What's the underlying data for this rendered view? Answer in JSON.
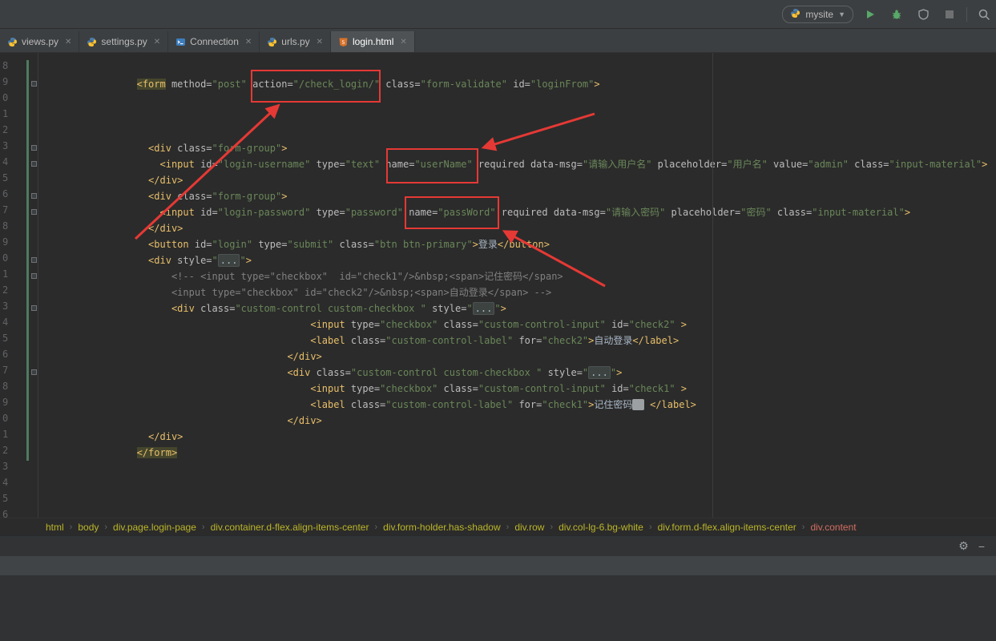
{
  "toolbar": {
    "run_config": "mysite"
  },
  "icons": {
    "gear": "⚙",
    "hide": "−"
  },
  "tabs": [
    {
      "label": "views.py",
      "icon": "python",
      "active": false
    },
    {
      "label": "settings.py",
      "icon": "python",
      "active": false
    },
    {
      "label": "Connection",
      "icon": "console",
      "active": false
    },
    {
      "label": "urls.py",
      "icon": "python",
      "active": false
    },
    {
      "label": "login.html",
      "icon": "html",
      "active": true
    }
  ],
  "editor": {
    "change_bar": {
      "from_row": 0,
      "to_row": 24
    },
    "fold_rows": [
      1,
      5,
      6,
      8,
      9,
      12,
      13,
      15,
      19
    ],
    "lines": [
      {
        "n": "8",
        "ind": 0,
        "segs": []
      },
      {
        "n": "9",
        "ind": 16,
        "segs": [
          [
            "T",
            "<form"
          ],
          [
            "a",
            " method="
          ],
          [
            "v",
            "\"post\""
          ],
          [
            "a",
            " action="
          ],
          [
            "v",
            "\"/check_login/\""
          ],
          [
            "a",
            " class="
          ],
          [
            "v",
            "\"form-validate\""
          ],
          [
            "a",
            " id="
          ],
          [
            "v",
            "\"loginFrom\""
          ],
          [
            "t",
            ">"
          ]
        ]
      },
      {
        "n": "0",
        "ind": 0,
        "segs": []
      },
      {
        "n": "1",
        "ind": 0,
        "segs": []
      },
      {
        "n": "2",
        "ind": 0,
        "segs": []
      },
      {
        "n": "3",
        "ind": 18,
        "segs": [
          [
            "t",
            "<div"
          ],
          [
            "a",
            " class="
          ],
          [
            "v",
            "\"form-group\""
          ],
          [
            "t",
            ">"
          ]
        ]
      },
      {
        "n": "4",
        "ind": 20,
        "segs": [
          [
            "t",
            "<input"
          ],
          [
            "a",
            " id="
          ],
          [
            "v",
            "\"login-username\""
          ],
          [
            "a",
            " type="
          ],
          [
            "v",
            "\"text\""
          ],
          [
            "a",
            " name="
          ],
          [
            "v",
            "\"userName\""
          ],
          [
            "a",
            " required"
          ],
          [
            "a",
            " data-msg="
          ],
          [
            "v",
            "\"请输入用户名\""
          ],
          [
            "a",
            " placeholder="
          ],
          [
            "v",
            "\"用户名\""
          ],
          [
            "a",
            " value="
          ],
          [
            "v",
            "\"admin\""
          ],
          [
            "a",
            " class="
          ],
          [
            "v",
            "\"input-material\""
          ],
          [
            "t",
            ">"
          ]
        ]
      },
      {
        "n": "5",
        "ind": 18,
        "segs": [
          [
            "t",
            "</div>"
          ]
        ]
      },
      {
        "n": "6",
        "ind": 18,
        "segs": [
          [
            "t",
            "<div"
          ],
          [
            "a",
            " class="
          ],
          [
            "v",
            "\"form-group\""
          ],
          [
            "t",
            ">"
          ]
        ]
      },
      {
        "n": "7",
        "ind": 20,
        "segs": [
          [
            "t",
            "<input"
          ],
          [
            "a",
            " id="
          ],
          [
            "v",
            "\"login-password\""
          ],
          [
            "a",
            " type="
          ],
          [
            "v",
            "\"password\""
          ],
          [
            "a",
            " name="
          ],
          [
            "v",
            "\"passWord\""
          ],
          [
            "a",
            " required"
          ],
          [
            "a",
            " data-msg="
          ],
          [
            "v",
            "\"请输入密码\""
          ],
          [
            "a",
            " placeholder="
          ],
          [
            "v",
            "\"密码\""
          ],
          [
            "a",
            " class="
          ],
          [
            "v",
            "\"input-material\""
          ],
          [
            "t",
            ">"
          ]
        ]
      },
      {
        "n": "8",
        "ind": 18,
        "segs": [
          [
            "t",
            "</div>"
          ]
        ]
      },
      {
        "n": "9",
        "ind": 18,
        "segs": [
          [
            "t",
            "<button"
          ],
          [
            "a",
            " id="
          ],
          [
            "v",
            "\"login\""
          ],
          [
            "a",
            " type="
          ],
          [
            "v",
            "\"submit\""
          ],
          [
            "a",
            " class="
          ],
          [
            "v",
            "\"btn btn-primary\""
          ],
          [
            "t",
            ">"
          ],
          [
            "x",
            "登录"
          ],
          [
            "t",
            "</button>"
          ]
        ]
      },
      {
        "n": "0",
        "ind": 18,
        "segs": [
          [
            "t",
            "<div"
          ],
          [
            "a",
            " style="
          ],
          [
            "v",
            "\""
          ],
          [
            "f",
            "..."
          ],
          [
            "v",
            "\""
          ],
          [
            "t",
            ">"
          ]
        ]
      },
      {
        "n": "1",
        "ind": 22,
        "segs": [
          [
            "c",
            "<!-- <input type=\"checkbox\"  id=\"check1\"/>&nbsp;<span>记住密码</span>"
          ]
        ]
      },
      {
        "n": "2",
        "ind": 22,
        "segs": [
          [
            "c",
            "<input type=\"checkbox\" id=\"check2\"/>&nbsp;<span>自动登录</span> -->"
          ]
        ]
      },
      {
        "n": "3",
        "ind": 22,
        "segs": [
          [
            "t",
            "<div"
          ],
          [
            "a",
            " class="
          ],
          [
            "v",
            "\"custom-control custom-checkbox \""
          ],
          [
            "a",
            " style="
          ],
          [
            "v",
            "\""
          ],
          [
            "f",
            "..."
          ],
          [
            "v",
            "\""
          ],
          [
            "t",
            ">"
          ]
        ]
      },
      {
        "n": "4",
        "ind": 46,
        "segs": [
          [
            "t",
            "<input"
          ],
          [
            "a",
            " type="
          ],
          [
            "v",
            "\"checkbox\""
          ],
          [
            "a",
            " class="
          ],
          [
            "v",
            "\"custom-control-input\""
          ],
          [
            "a",
            " id="
          ],
          [
            "v",
            "\"check2\""
          ],
          [
            "t",
            " >"
          ]
        ]
      },
      {
        "n": "5",
        "ind": 46,
        "segs": [
          [
            "t",
            "<label"
          ],
          [
            "a",
            " class="
          ],
          [
            "v",
            "\"custom-control-label\""
          ],
          [
            "a",
            " for="
          ],
          [
            "v",
            "\"check2\""
          ],
          [
            "t",
            ">"
          ],
          [
            "x",
            "自动登录"
          ],
          [
            "t",
            "</label>"
          ]
        ]
      },
      {
        "n": "6",
        "ind": 42,
        "segs": [
          [
            "t",
            "</div>"
          ]
        ]
      },
      {
        "n": "7",
        "ind": 42,
        "segs": [
          [
            "t",
            "<div"
          ],
          [
            "a",
            " class="
          ],
          [
            "v",
            "\"custom-control custom-checkbox \""
          ],
          [
            "a",
            " style="
          ],
          [
            "v",
            "\""
          ],
          [
            "f",
            "..."
          ],
          [
            "v",
            "\""
          ],
          [
            "t",
            ">"
          ]
        ]
      },
      {
        "n": "8",
        "ind": 46,
        "segs": [
          [
            "t",
            "<input"
          ],
          [
            "a",
            " type="
          ],
          [
            "v",
            "\"checkbox\""
          ],
          [
            "a",
            " class="
          ],
          [
            "v",
            "\"custom-control-input\""
          ],
          [
            "a",
            " id="
          ],
          [
            "v",
            "\"check1\""
          ],
          [
            "t",
            " >"
          ]
        ]
      },
      {
        "n": "9",
        "ind": 46,
        "segs": [
          [
            "t",
            "<label"
          ],
          [
            "a",
            " class="
          ],
          [
            "v",
            "\"custom-control-label\""
          ],
          [
            "a",
            " for="
          ],
          [
            "v",
            "\"check1\""
          ],
          [
            "t",
            ">"
          ],
          [
            "x",
            "记住密码"
          ],
          [
            "s",
            "  "
          ],
          [
            "x",
            " "
          ],
          [
            "t",
            "</label>"
          ]
        ]
      },
      {
        "n": "0",
        "ind": 42,
        "segs": [
          [
            "t",
            "</div>"
          ]
        ]
      },
      {
        "n": "1",
        "ind": 18,
        "segs": [
          [
            "t",
            "</div>"
          ]
        ]
      },
      {
        "n": "2",
        "ind": 16,
        "segs": [
          [
            "T",
            "</form>"
          ]
        ]
      },
      {
        "n": "3",
        "ind": 0,
        "segs": []
      },
      {
        "n": "4",
        "ind": 0,
        "segs": []
      },
      {
        "n": "5",
        "ind": 0,
        "segs": []
      },
      {
        "n": "6",
        "ind": 0,
        "segs": []
      }
    ]
  },
  "breadcrumbs": {
    "items": [
      {
        "label": "html",
        "current": false
      },
      {
        "label": "body",
        "current": false
      },
      {
        "label": "div.page.login-page",
        "current": false
      },
      {
        "label": "div.container.d-flex.align-items-center",
        "current": false
      },
      {
        "label": "div.form-holder.has-shadow",
        "current": false
      },
      {
        "label": "div.row",
        "current": false
      },
      {
        "label": "div.col-lg-6.bg-white",
        "current": false
      },
      {
        "label": "div.form.d-flex.align-items-center",
        "current": false
      },
      {
        "label": "div.content",
        "current": true
      }
    ]
  }
}
